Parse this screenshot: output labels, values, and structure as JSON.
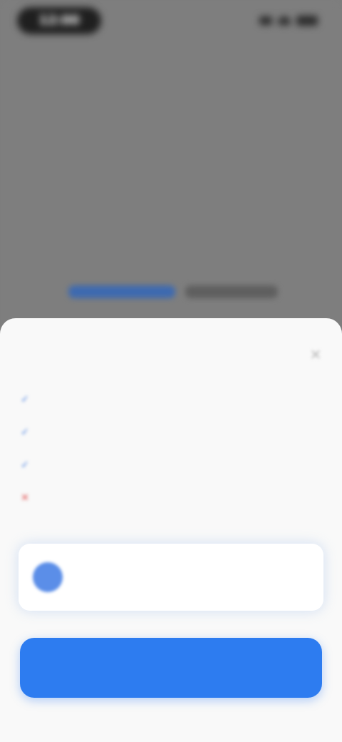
{
  "status_bar": {
    "time": "12:00"
  },
  "background": {
    "link_primary": "",
    "link_secondary": ""
  },
  "sheet": {
    "title": "",
    "close_icon": "close-icon",
    "permissions": [
      {
        "icon": "check-icon",
        "allowed": true,
        "text": ""
      },
      {
        "icon": "check-icon",
        "allowed": true,
        "text": ""
      },
      {
        "icon": "check-icon",
        "allowed": true,
        "text": ""
      },
      {
        "icon": "cross-icon",
        "allowed": false,
        "text": ""
      }
    ],
    "account": {
      "avatar_initial": "",
      "name": "",
      "handle": "",
      "switch_label": ""
    },
    "primary_button_label": ""
  },
  "colors": {
    "accent": "#2d7cf0",
    "deny": "#e04b4b",
    "overlay": "#7e7e7e",
    "sheet_bg": "#f9f9f9"
  }
}
